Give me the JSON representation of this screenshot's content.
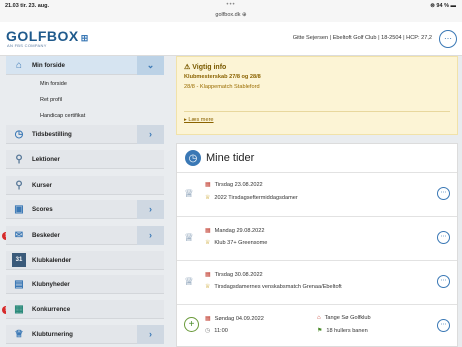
{
  "status": {
    "time": "21.03  tir. 23. aug.",
    "dots": "•••",
    "url": "golfbox.dk ⊕",
    "right": "⊜ 94 % ▬"
  },
  "header": {
    "logo": "GOLFBOX",
    "logo_sub": "AN FBS COMPANY",
    "user_info": "Gitte Sejersen  |  Ebeltoft Golf Club  |  18-2504  |  HCP: 27,2",
    "user_btn": "⋯"
  },
  "sidebar": {
    "min_forside": "Min forside",
    "sub": [
      "Min forside",
      "Ret profil",
      "Handicap certifikat"
    ],
    "items": [
      {
        "label": "Tidsbestilling"
      },
      {
        "label": "Lektioner"
      },
      {
        "label": "Kurser"
      },
      {
        "label": "Scores"
      },
      {
        "label": "Beskeder"
      },
      {
        "label": "Klubkalender"
      },
      {
        "label": "Klubnyheder"
      },
      {
        "label": "Konkurrence"
      },
      {
        "label": "Klubturnering"
      }
    ],
    "arrow": "›",
    "arrow_down": "⌄",
    "badge": "!",
    "cal_text": "31"
  },
  "info": {
    "title": "⚠  Vigtig info",
    "line1": "Klubmesterskab 27/8 og 28/8",
    "line2": "28/8  - Klappematch Stableford",
    "more": "▸ Læs mere"
  },
  "times": {
    "title": "Mine tider",
    "entries": [
      {
        "date": "Tirsdag 23.08.2022",
        "name": "2022 Tirsdagseftermiddagsdamer"
      },
      {
        "date": "Mandag 29.08.2022",
        "name": "Klub 37+ Greensome"
      },
      {
        "date": "Tirsdag 30.08.2022",
        "name": "Tirsdagsdamernes venskabsmatch Grenaa/Ebeltoft"
      },
      {
        "date": "Søndag 04.09.2022",
        "time": "11:00",
        "club": "Tange Sø Golfklub",
        "course": "18 hullers banen"
      }
    ],
    "more": "⋯"
  }
}
